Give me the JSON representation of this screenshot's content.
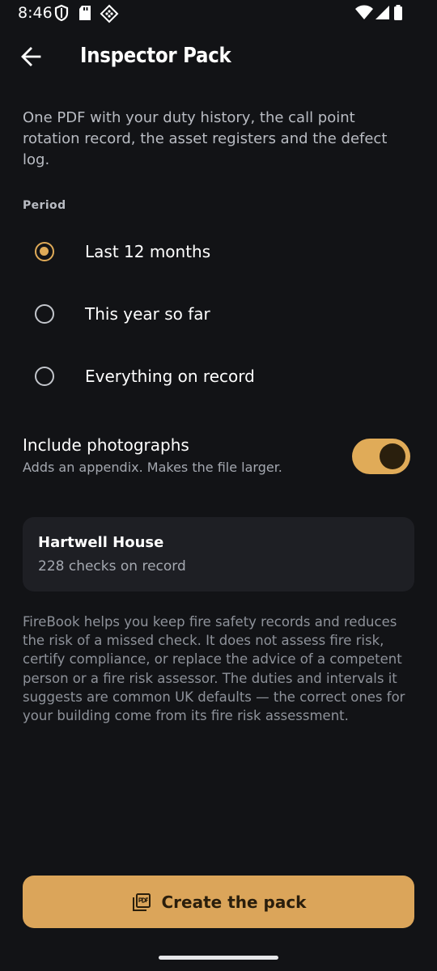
{
  "status_bar": {
    "time": "8:46",
    "left_icons": [
      "shield-icon",
      "sd-card-icon",
      "tap-icon"
    ],
    "right_icons": [
      "wifi-icon",
      "cellular-signal-icon",
      "battery-icon"
    ]
  },
  "app_bar": {
    "back_icon": "arrow-left-icon",
    "title": "Inspector Pack"
  },
  "intro": "One PDF with your duty history, the call point rotation record, the asset registers and the defect log.",
  "period": {
    "label": "Period",
    "options": [
      {
        "label": "Last 12 months",
        "selected": true
      },
      {
        "label": "This year so far",
        "selected": false
      },
      {
        "label": "Everything on record",
        "selected": false
      }
    ]
  },
  "photographs": {
    "title": "Include photographs",
    "subtitle": "Adds an appendix. Makes the file larger.",
    "enabled": true
  },
  "property_card": {
    "name": "Hartwell House",
    "checks": "228 checks on record"
  },
  "disclaimer": "FireBook helps you keep fire safety records and reduces the risk of a missed check. It does not assess fire risk, certify compliance, or replace the advice of a competent person or a fire risk assessor. The duties and intervals it suggests are common UK defaults — the correct ones for your building come from its fire risk assessment.",
  "cta": {
    "icon": "pdf-icon",
    "label": "Create the pack"
  },
  "colors": {
    "background": "#121316",
    "accent": "#E0AB58",
    "card": "#1E1F24"
  }
}
